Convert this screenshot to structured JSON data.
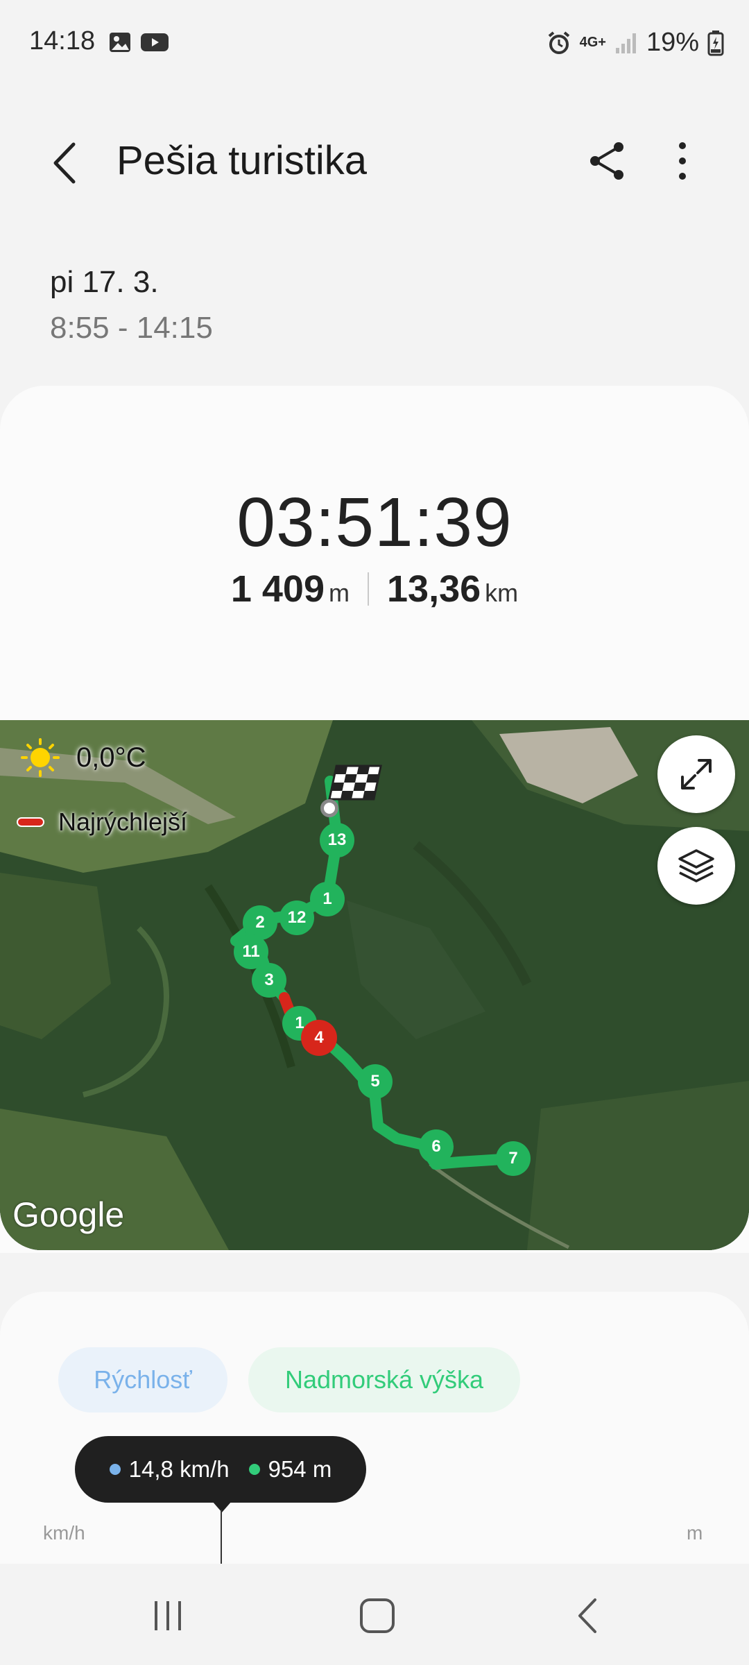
{
  "status_bar": {
    "time": "14:18",
    "network": "4G+",
    "battery": "19%"
  },
  "header": {
    "title": "Pešia turistika"
  },
  "session": {
    "date": "pi 17. 3.",
    "time_range": "8:55 - 14:15"
  },
  "summary": {
    "duration": "03:51:39",
    "elevation_value": "1 409",
    "elevation_unit": "m",
    "distance_value": "13,36",
    "distance_unit": "km"
  },
  "map": {
    "temperature": "0,0°C",
    "legend_label": "Najrýchlejší",
    "attribution": "Google",
    "route_color": "#22b35c",
    "fastest_color": "#d7261b",
    "markers": [
      "13",
      "1",
      "12",
      "2",
      "11",
      "3",
      "1",
      "4",
      "5",
      "6",
      "7"
    ]
  },
  "chart": {
    "tab_speed": "Rýchlosť",
    "tab_altitude": "Nadmorská výška",
    "tooltip_speed": "14,8 km/h",
    "tooltip_altitude": "954 m",
    "axis_left_unit": "km/h",
    "axis_right_unit": "m",
    "speed_color": "#7ab2ea",
    "altitude_color": "#32cc7a"
  }
}
